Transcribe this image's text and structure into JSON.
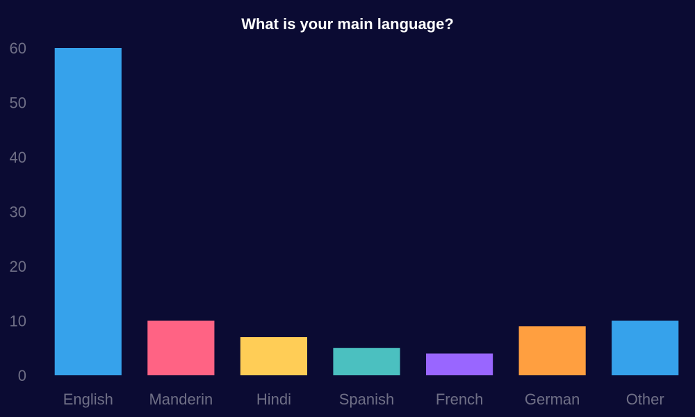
{
  "chart_data": {
    "type": "bar",
    "title": "What is your main language?",
    "categories": [
      "English",
      "Manderin",
      "Hindi",
      "Spanish",
      "French",
      "German",
      "Other"
    ],
    "values": [
      60,
      10,
      7,
      5,
      4,
      9,
      10
    ],
    "colors": [
      "#36a2eb",
      "#ff6384",
      "#ffcd56",
      "#4bc0c0",
      "#9966ff",
      "#ff9f40",
      "#36a2eb"
    ],
    "xlabel": "",
    "ylabel": "",
    "ylim": [
      0,
      60
    ],
    "yticks": [
      "0",
      "10",
      "20",
      "30",
      "40",
      "50",
      "60"
    ],
    "grid": false,
    "legend": "none"
  },
  "theme": {
    "background": "#0b0b33",
    "title_color": "#ffffff",
    "tick_color": "#6f6f86"
  }
}
